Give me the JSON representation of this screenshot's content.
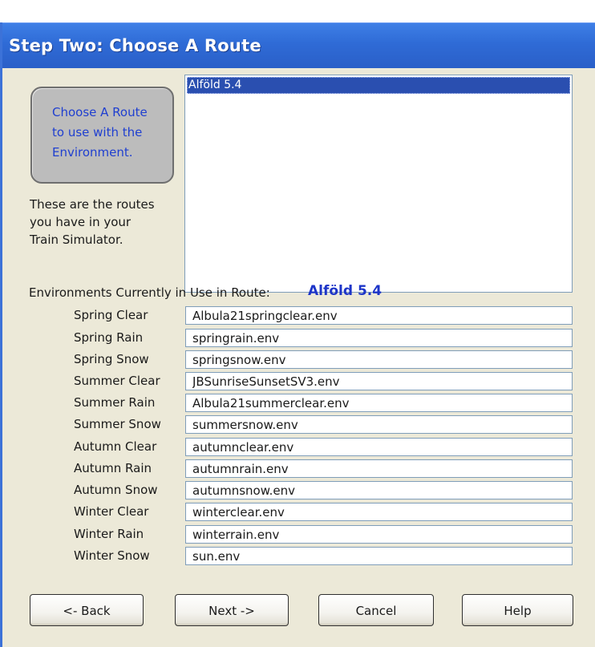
{
  "window": {
    "title": "Step Two: Choose A Route"
  },
  "info_box": {
    "lines": [
      "Choose A Route",
      "to use with the",
      "Environment."
    ]
  },
  "description": {
    "lines": [
      "These are the routes",
      "you have in your",
      "Train Simulator."
    ]
  },
  "routes": {
    "items": [
      {
        "label": "Alföld 5.4",
        "selected": true
      }
    ]
  },
  "environments": {
    "header_label": "Environments Currently in Use in Route:",
    "route_name": "Alföld 5.4",
    "rows": [
      {
        "label": "Spring Clear",
        "value": "Albula21springclear.env"
      },
      {
        "label": "Spring Rain",
        "value": "springrain.env"
      },
      {
        "label": "Spring Snow",
        "value": "springsnow.env"
      },
      {
        "label": "Summer Clear",
        "value": "JBSunriseSunsetSV3.env"
      },
      {
        "label": "Summer Rain",
        "value": "Albula21summerclear.env"
      },
      {
        "label": "Summer Snow",
        "value": "summersnow.env"
      },
      {
        "label": "Autumn Clear",
        "value": "autumnclear.env"
      },
      {
        "label": "Autumn Rain",
        "value": "autumnrain.env"
      },
      {
        "label": "Autumn Snow",
        "value": "autumnsnow.env"
      },
      {
        "label": "Winter Clear",
        "value": "winterclear.env"
      },
      {
        "label": "Winter Rain",
        "value": "winterrain.env"
      },
      {
        "label": "Winter Snow",
        "value": "sun.env"
      }
    ]
  },
  "buttons": {
    "back": "<- Back",
    "next": "Next ->",
    "cancel": "Cancel",
    "help": "Help"
  },
  "colors": {
    "title_bar": "#2f6bd6",
    "selection": "#2a4fb0",
    "info_text": "#1f3fd0",
    "route_name": "#1d35c8"
  }
}
